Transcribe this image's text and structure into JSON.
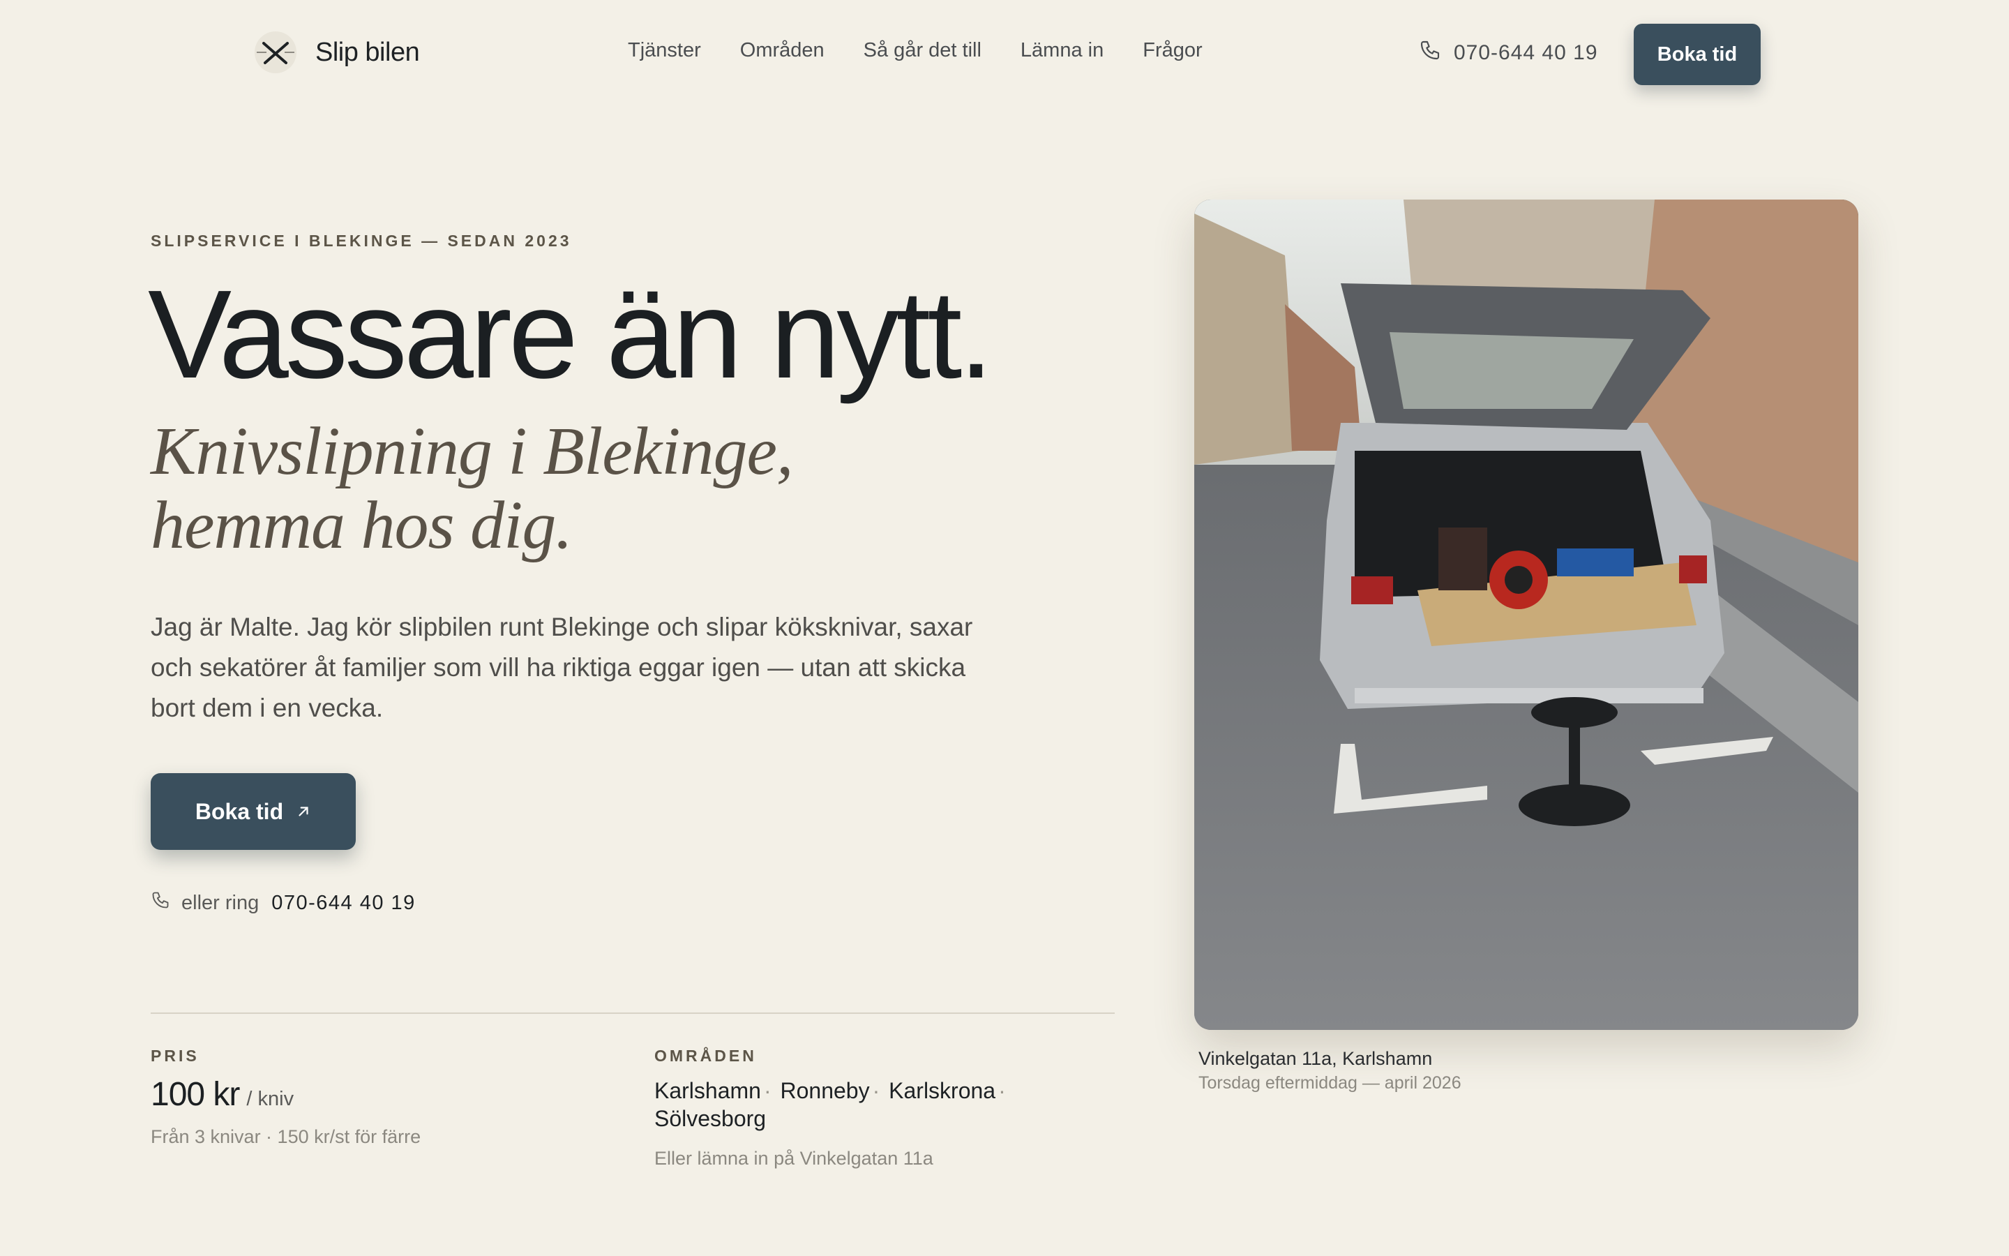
{
  "colors": {
    "background": "#f3f0e7",
    "accent": "#3a4f5d",
    "heading": "#1b1f22",
    "subheading": "#5a5247"
  },
  "header": {
    "brand": "Slip bilen",
    "nav": [
      "Tjänster",
      "Områden",
      "Så går det till",
      "Lämna in",
      "Frågor"
    ],
    "phone": "070-644 40 19",
    "cta": "Boka tid"
  },
  "hero": {
    "eyebrow": "SLIPSERVICE I BLEKINGE — SEDAN 2023",
    "title": "Vassare än nytt.",
    "subtitle_line1": "Knivslipning i Blekinge,",
    "subtitle_line2": "hemma hos dig.",
    "lead": "Jag är Malte. Jag kör slipbilen runt Blekinge och slipar köksknivar, saxar och sekatörer åt familjer som vill ha riktiga eggar igen — utan att skicka bort dem i en vecka.",
    "cta": "Boka tid",
    "call_prefix": "eller ring",
    "call_number": "070-644 40 19"
  },
  "stats": {
    "price_label": "PRIS",
    "price_value": "100 kr",
    "price_unit": "/ kniv",
    "price_note": "Från 3 knivar · 150 kr/st för färre",
    "areas_label": "OMRÅDEN",
    "areas": [
      "Karlshamn",
      "Ronneby",
      "Karlskrona",
      "Sölvesborg"
    ],
    "areas_note": "Eller lämna in på Vinkelgatan 11a"
  },
  "photo": {
    "caption_place": "Vinkelgatan 11a, Karlshamn",
    "caption_time": "Torsdag eftermiddag — april 2026"
  },
  "icons": {
    "logo": "crossed-knives-icon",
    "phone": "phone-icon",
    "arrow": "arrow-up-right-icon"
  }
}
